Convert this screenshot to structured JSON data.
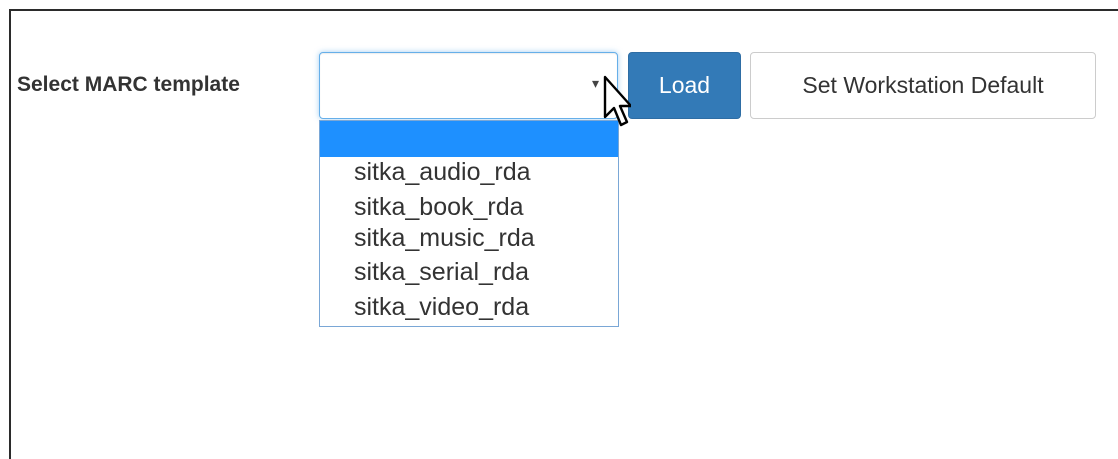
{
  "form": {
    "label": "Select MARC template",
    "select": {
      "selected_value": "",
      "caret_icon": "▾",
      "options": [
        "",
        "sitka_audio_rda",
        "sitka_book_rda",
        "sitka_music_rda",
        "sitka_serial_rda",
        "sitka_video_rda"
      ]
    },
    "load_button": "Load",
    "default_button": "Set Workstation Default"
  },
  "colors": {
    "primary": "#337ab7",
    "highlight": "#1e90ff",
    "focus_border": "#66afe9"
  }
}
